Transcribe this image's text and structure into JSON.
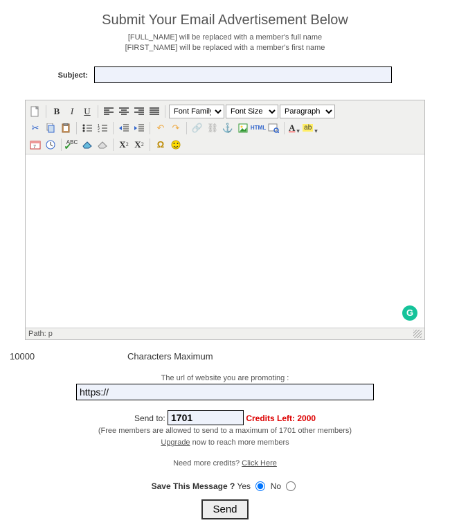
{
  "heading": "Submit Your Email Advertisement Below",
  "note1": "[FULL_NAME] will be replaced with a member's full name",
  "note2": "[FIRST_NAME] will be replaced with a member's first name",
  "subject": {
    "label": "Subject:",
    "value": ""
  },
  "toolbar": {
    "selects": {
      "family": "Font Family",
      "size": "Font Size",
      "para": "Paragraph"
    },
    "html_label": "HTML"
  },
  "path": {
    "label": "Path: p"
  },
  "char": {
    "count": "10000",
    "label": "Characters Maximum"
  },
  "url": {
    "label": "The url of website you are promoting :",
    "value": "https://"
  },
  "sendto": {
    "label": "Send to:",
    "value": "1701"
  },
  "credits_left": "Credits Left: 2000",
  "free_note": "(Free members are allowed to send to a maximum of 1701 other members)",
  "upgrade_link": "Upgrade",
  "upgrade_rest": " now to reach more members",
  "need_credits": "Need more credits? ",
  "click_here": "Click Here",
  "save": {
    "label": "Save This Message ?",
    "yes": "Yes",
    "no": "No",
    "selected": "yes"
  },
  "send_btn": "Send",
  "grammarly": "G"
}
